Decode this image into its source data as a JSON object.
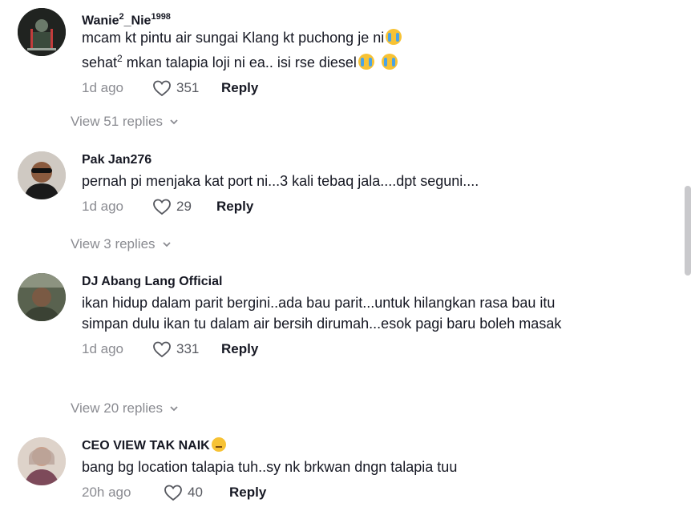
{
  "comments": [
    {
      "username": "Wanie",
      "username_sup1": "2",
      "username_mid": "_Nie",
      "username_sup2": "1998",
      "line1": "mcam kt pintu air sungai Klang kt puchong je ni",
      "line2_a": "sehat",
      "line2_sup": "2",
      "line2_b": " mkan talapia loji ni ea.. isi rse diesel",
      "time": "1d ago",
      "likes": "351",
      "reply": "Reply",
      "view_replies": "View 51 replies"
    },
    {
      "username": "Pak Jan276",
      "text": "pernah pi menjaka kat port ni...3 kali tebaq jala....dpt seguni....",
      "time": "1d ago",
      "likes": "29",
      "reply": "Reply",
      "view_replies": "View 3 replies"
    },
    {
      "username": "DJ Abang Lang Official",
      "text": "ikan hidup dalam parit bergini..ada bau parit...untuk hilangkan rasa bau itu simpan dulu ikan tu dalam air bersih dirumah...esok pagi baru boleh masak",
      "time": "1d ago",
      "likes": "331",
      "reply": "Reply",
      "view_replies": "View 20 replies"
    },
    {
      "username": "CEO VIEW TAK NAIK",
      "text": "bang bg location talapia tuh..sy nk brkwan dngn talapia tuu",
      "time": "20h ago",
      "likes": "40",
      "reply": "Reply"
    }
  ]
}
